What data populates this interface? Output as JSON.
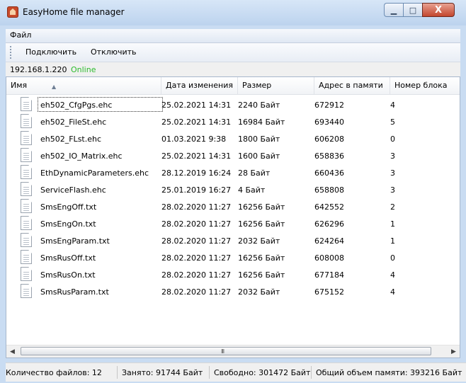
{
  "window": {
    "title": "EasyHome file manager",
    "close_glyph": "X",
    "minimize_glyph": "▁",
    "maximize_glyph": "□"
  },
  "menu": {
    "file": "Файл"
  },
  "toolbar": {
    "connect": "Подключить",
    "disconnect": "Отключить"
  },
  "connection": {
    "ip": "192.168.1.220",
    "status": "Online",
    "status_color": "#2dbb2d"
  },
  "table": {
    "columns": [
      "Имя",
      "Дата изменения",
      "Размер",
      "Адрес в памяти",
      "Номер блока"
    ],
    "rows": [
      [
        "eh502_CfgPgs.ehc",
        "25.02.2021 14:31",
        "2240 Байт",
        "672912",
        "4"
      ],
      [
        "eh502_FileSt.ehc",
        "25.02.2021 14:31",
        "16984 Байт",
        "693440",
        "5"
      ],
      [
        "eh502_FLst.ehc",
        "01.03.2021 9:38",
        "1800 Байт",
        "606208",
        "0"
      ],
      [
        "eh502_IO_Matrix.ehc",
        "25.02.2021 14:31",
        "1600 Байт",
        "658836",
        "3"
      ],
      [
        "EthDynamicParameters.ehc",
        "28.12.2019 16:24",
        "28 Байт",
        "660436",
        "3"
      ],
      [
        "ServiceFlash.ehc",
        "25.01.2019 16:27",
        "4 Байт",
        "658808",
        "3"
      ],
      [
        "SmsEngOff.txt",
        "28.02.2020 11:27",
        "16256 Байт",
        "642552",
        "2"
      ],
      [
        "SmsEngOn.txt",
        "28.02.2020 11:27",
        "16256 Байт",
        "626296",
        "1"
      ],
      [
        "SmsEngParam.txt",
        "28.02.2020 11:27",
        "2032 Байт",
        "624264",
        "1"
      ],
      [
        "SmsRusOff.txt",
        "28.02.2020 11:27",
        "16256 Байт",
        "608008",
        "0"
      ],
      [
        "SmsRusOn.txt",
        "28.02.2020 11:27",
        "16256 Байт",
        "677184",
        "4"
      ],
      [
        "SmsRusParam.txt",
        "28.02.2020 11:27",
        "2032 Байт",
        "675152",
        "4"
      ]
    ]
  },
  "statusbar": {
    "file_count": "Количество файлов: 12",
    "used": "Занято: 91744 Байт",
    "free": "Свободно: 301472 Байт",
    "total": "Общий объем памяти: 393216 Байт"
  },
  "scrollbar": {
    "left_glyph": "◀",
    "right_glyph": "▶",
    "grip_glyph": "III"
  },
  "icons": {
    "file": "document-icon",
    "app": "app-icon",
    "sort": "sort-ascending-icon"
  }
}
